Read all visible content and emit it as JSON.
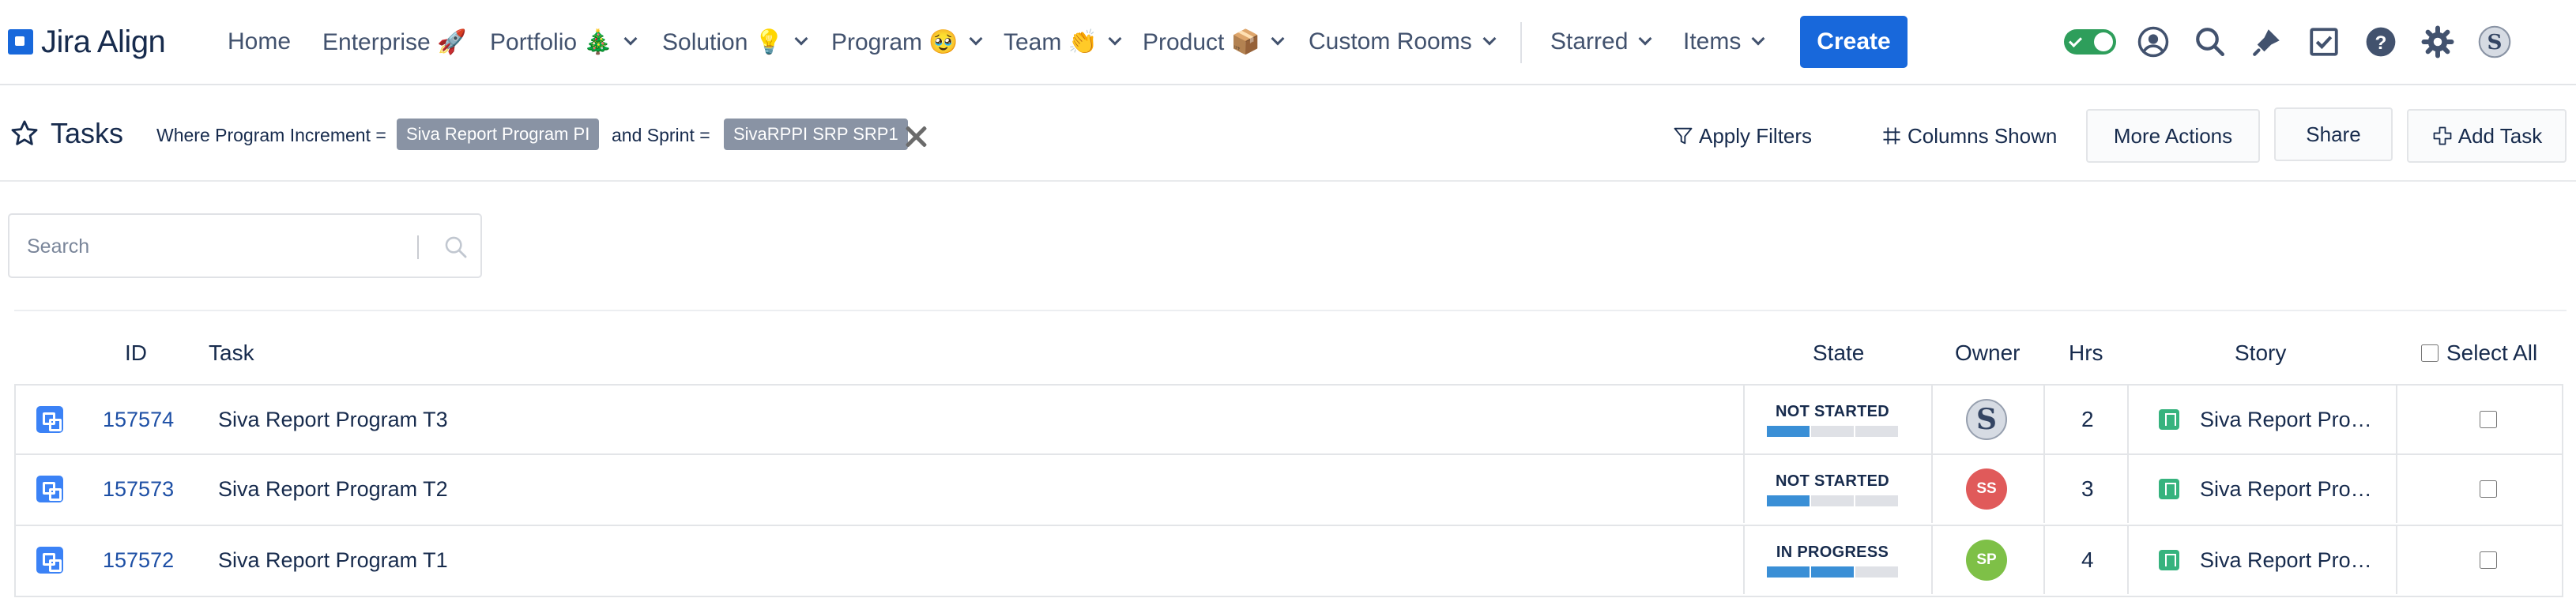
{
  "app": {
    "logo_text": "Jira Align"
  },
  "nav": {
    "items": [
      {
        "label": "Home",
        "has_menu": false
      },
      {
        "label": "Enterprise 🚀",
        "has_menu": false
      },
      {
        "label": "Portfolio 🎄",
        "has_menu": true
      },
      {
        "label": "Solution 💡",
        "has_menu": true
      },
      {
        "label": "Program 🥹",
        "has_menu": true
      },
      {
        "label": "Team 👏",
        "has_menu": true
      },
      {
        "label": "Product 📦",
        "has_menu": true
      },
      {
        "label": "Custom Rooms",
        "has_menu": true
      },
      {
        "label": "Starred",
        "has_menu": true
      },
      {
        "label": "Items",
        "has_menu": true
      }
    ],
    "create_label": "Create",
    "toggle_on": true,
    "icons": [
      "user-profile-icon",
      "search-icon",
      "notifications-icon",
      "checklist-icon",
      "help-icon",
      "settings-icon",
      "avatar"
    ]
  },
  "subheader": {
    "title": "Tasks",
    "filter": {
      "pi_prefix": "Where Program Increment =",
      "pi_value": "Siva Report Program PI",
      "sprint_prefix": "and Sprint =",
      "sprint_value": "SivaRPPI SRP SRP1"
    },
    "actions": {
      "apply_filters": "Apply Filters",
      "columns_shown": "Columns Shown",
      "more_actions": "More Actions",
      "share": "Share",
      "add_task": "Add Task"
    }
  },
  "search": {
    "placeholder": "Search",
    "value": ""
  },
  "table": {
    "headers": {
      "id": "ID",
      "task": "Task",
      "state": "State",
      "owner": "Owner",
      "hrs": "Hrs",
      "story": "Story",
      "select_all": "Select All"
    },
    "rows": [
      {
        "id": "157574",
        "task": "Siva Report Program T3",
        "state": "NOT STARTED",
        "progress_segments": 1,
        "owner": {
          "initials": "",
          "color": "#d6dbe3",
          "is_image": true
        },
        "hrs": "2",
        "story": "Siva Report Pro…",
        "checked": false
      },
      {
        "id": "157573",
        "task": "Siva Report Program T2",
        "state": "NOT STARTED",
        "progress_segments": 1,
        "owner": {
          "initials": "SS",
          "color": "#e05a5a",
          "is_image": false
        },
        "hrs": "3",
        "story": "Siva Report Pro…",
        "checked": false
      },
      {
        "id": "157572",
        "task": "Siva Report Program T1",
        "state": "IN PROGRESS",
        "progress_segments": 2,
        "owner": {
          "initials": "SP",
          "color": "#7ec047",
          "is_image": false
        },
        "hrs": "4",
        "story": "Siva Report Pro…",
        "checked": false
      }
    ]
  },
  "colors": {
    "brand": "#1868db",
    "toggle": "#2e9e5b",
    "progress": "#3a8fd6",
    "link": "#1d4fa5",
    "story": "#36b37e"
  }
}
